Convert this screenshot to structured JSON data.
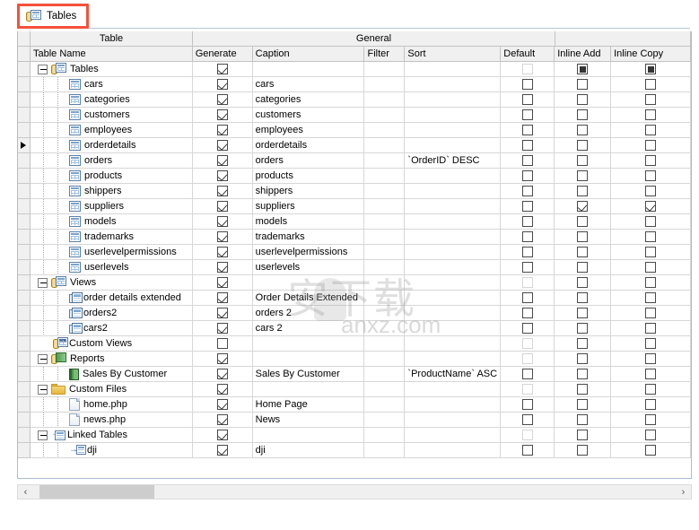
{
  "tab": {
    "label": "Tables",
    "icon": "tables-icon",
    "highlight_color": "#f4513b"
  },
  "grid": {
    "group_headers": [
      {
        "label": "Table"
      },
      {
        "label": "General"
      },
      {
        "label": ""
      }
    ],
    "columns": [
      {
        "label": "Table Name"
      },
      {
        "label": "Generate"
      },
      {
        "label": "Caption"
      },
      {
        "label": "Filter"
      },
      {
        "label": "Sort"
      },
      {
        "label": "Default"
      },
      {
        "label": "Inline Add"
      },
      {
        "label": "Inline Copy"
      }
    ],
    "rows": [
      {
        "name": "Tables",
        "icon": "group-tables-icon",
        "level": 0,
        "expander": "minus",
        "generate": "checked",
        "caption": "",
        "filter": "",
        "sort": "",
        "default": "disabled",
        "inline_add": "indeterminate",
        "inline_copy": "indeterminate",
        "pointer": false
      },
      {
        "name": "cars",
        "icon": "table-icon",
        "level": 1,
        "expander": "none",
        "generate": "checked",
        "caption": "cars",
        "filter": "",
        "sort": "",
        "default": "unchecked",
        "inline_add": "unchecked",
        "inline_copy": "unchecked",
        "pointer": false
      },
      {
        "name": "categories",
        "icon": "table-icon",
        "level": 1,
        "expander": "none",
        "generate": "checked",
        "caption": "categories",
        "filter": "",
        "sort": "",
        "default": "unchecked",
        "inline_add": "unchecked",
        "inline_copy": "unchecked",
        "pointer": false
      },
      {
        "name": "customers",
        "icon": "table-icon",
        "level": 1,
        "expander": "none",
        "generate": "checked",
        "caption": "customers",
        "filter": "",
        "sort": "",
        "default": "unchecked",
        "inline_add": "unchecked",
        "inline_copy": "unchecked",
        "pointer": false
      },
      {
        "name": "employees",
        "icon": "table-icon",
        "level": 1,
        "expander": "none",
        "generate": "checked",
        "caption": "employees",
        "filter": "",
        "sort": "",
        "default": "unchecked",
        "inline_add": "unchecked",
        "inline_copy": "unchecked",
        "pointer": false
      },
      {
        "name": "orderdetails",
        "icon": "table-icon",
        "level": 1,
        "expander": "none",
        "generate": "checked",
        "caption": "orderdetails",
        "filter": "",
        "sort": "",
        "default": "unchecked",
        "inline_add": "unchecked",
        "inline_copy": "unchecked",
        "pointer": true
      },
      {
        "name": "orders",
        "icon": "table-icon",
        "level": 1,
        "expander": "none",
        "generate": "checked",
        "caption": "orders",
        "filter": "",
        "sort": "`OrderID` DESC",
        "default": "unchecked",
        "inline_add": "unchecked",
        "inline_copy": "unchecked",
        "pointer": false
      },
      {
        "name": "products",
        "icon": "table-icon",
        "level": 1,
        "expander": "none",
        "generate": "checked",
        "caption": "products",
        "filter": "",
        "sort": "",
        "default": "unchecked",
        "inline_add": "unchecked",
        "inline_copy": "unchecked",
        "pointer": false
      },
      {
        "name": "shippers",
        "icon": "table-icon",
        "level": 1,
        "expander": "none",
        "generate": "checked",
        "caption": "shippers",
        "filter": "",
        "sort": "",
        "default": "unchecked",
        "inline_add": "unchecked",
        "inline_copy": "unchecked",
        "pointer": false
      },
      {
        "name": "suppliers",
        "icon": "table-icon",
        "level": 1,
        "expander": "none",
        "generate": "checked",
        "caption": "suppliers",
        "filter": "",
        "sort": "",
        "default": "unchecked",
        "inline_add": "checked",
        "inline_copy": "checked",
        "pointer": false
      },
      {
        "name": "models",
        "icon": "table-icon",
        "level": 1,
        "expander": "none",
        "generate": "checked",
        "caption": "models",
        "filter": "",
        "sort": "",
        "default": "unchecked",
        "inline_add": "unchecked",
        "inline_copy": "unchecked",
        "pointer": false
      },
      {
        "name": "trademarks",
        "icon": "table-icon",
        "level": 1,
        "expander": "none",
        "generate": "checked",
        "caption": "trademarks",
        "filter": "",
        "sort": "",
        "default": "unchecked",
        "inline_add": "unchecked",
        "inline_copy": "unchecked",
        "pointer": false
      },
      {
        "name": "userlevelpermissions",
        "icon": "table-icon",
        "level": 1,
        "expander": "none",
        "generate": "checked",
        "caption": "userlevelpermissions",
        "filter": "",
        "sort": "",
        "default": "unchecked",
        "inline_add": "unchecked",
        "inline_copy": "unchecked",
        "pointer": false
      },
      {
        "name": "userlevels",
        "icon": "table-icon",
        "level": 1,
        "expander": "none",
        "generate": "checked",
        "caption": "userlevels",
        "filter": "",
        "sort": "",
        "default": "unchecked",
        "inline_add": "unchecked",
        "inline_copy": "unchecked",
        "pointer": false
      },
      {
        "name": "Views",
        "icon": "group-views-icon",
        "level": 0,
        "expander": "minus",
        "generate": "checked",
        "caption": "",
        "filter": "",
        "sort": "",
        "default": "disabled",
        "inline_add": "unchecked",
        "inline_copy": "unchecked",
        "pointer": false
      },
      {
        "name": "order details extended",
        "icon": "view-icon",
        "level": 1,
        "expander": "none",
        "generate": "checked",
        "caption": "Order Details Extended",
        "filter": "",
        "sort": "",
        "default": "unchecked",
        "inline_add": "unchecked",
        "inline_copy": "unchecked",
        "pointer": false
      },
      {
        "name": "orders2",
        "icon": "view-icon",
        "level": 1,
        "expander": "none",
        "generate": "checked",
        "caption": "orders 2",
        "filter": "",
        "sort": "",
        "default": "unchecked",
        "inline_add": "unchecked",
        "inline_copy": "unchecked",
        "pointer": false
      },
      {
        "name": "cars2",
        "icon": "view-icon",
        "level": 1,
        "expander": "none",
        "generate": "checked",
        "caption": "cars 2",
        "filter": "",
        "sort": "",
        "default": "unchecked",
        "inline_add": "unchecked",
        "inline_copy": "unchecked",
        "pointer": false
      },
      {
        "name": "Custom Views",
        "icon": "group-sql-views-icon",
        "level": 0,
        "expander": "none",
        "generate": "unchecked",
        "caption": "",
        "filter": "",
        "sort": "",
        "default": "disabled",
        "inline_add": "unchecked",
        "inline_copy": "unchecked",
        "pointer": false
      },
      {
        "name": "Reports",
        "icon": "group-reports-icon",
        "level": 0,
        "expander": "minus",
        "generate": "checked",
        "caption": "",
        "filter": "",
        "sort": "",
        "default": "disabled",
        "inline_add": "unchecked",
        "inline_copy": "unchecked",
        "pointer": false
      },
      {
        "name": "Sales By Customer",
        "icon": "report-icon",
        "level": 1,
        "expander": "none",
        "generate": "checked",
        "caption": "Sales By Customer",
        "filter": "",
        "sort": "`ProductName` ASC",
        "default": "unchecked",
        "inline_add": "unchecked",
        "inline_copy": "unchecked",
        "pointer": false
      },
      {
        "name": "Custom Files",
        "icon": "folder-icon",
        "level": 0,
        "expander": "minus",
        "generate": "checked",
        "caption": "",
        "filter": "",
        "sort": "",
        "default": "disabled",
        "inline_add": "unchecked",
        "inline_copy": "unchecked",
        "pointer": false
      },
      {
        "name": "home.php",
        "icon": "file-icon",
        "level": 1,
        "expander": "none",
        "generate": "checked",
        "caption": "Home Page",
        "filter": "",
        "sort": "",
        "default": "unchecked",
        "inline_add": "unchecked",
        "inline_copy": "unchecked",
        "pointer": false
      },
      {
        "name": "news.php",
        "icon": "file-icon",
        "level": 1,
        "expander": "none",
        "generate": "checked",
        "caption": "News",
        "filter": "",
        "sort": "",
        "default": "unchecked",
        "inline_add": "unchecked",
        "inline_copy": "unchecked",
        "pointer": false
      },
      {
        "name": "Linked Tables",
        "icon": "group-linked-tables-icon",
        "level": 0,
        "expander": "minus",
        "generate": "checked",
        "caption": "",
        "filter": "",
        "sort": "",
        "default": "disabled",
        "inline_add": "unchecked",
        "inline_copy": "unchecked",
        "pointer": false
      },
      {
        "name": "dji",
        "icon": "linked-table-icon",
        "level": 1,
        "expander": "none",
        "generate": "checked",
        "caption": "dji",
        "filter": "",
        "sort": "",
        "default": "unchecked",
        "inline_add": "unchecked",
        "inline_copy": "unchecked",
        "pointer": false
      }
    ]
  },
  "scrollbar": {
    "left_arrow": "‹",
    "right_arrow": "›"
  },
  "watermark": {
    "logo": "安下载",
    "text": "anxz.com"
  }
}
